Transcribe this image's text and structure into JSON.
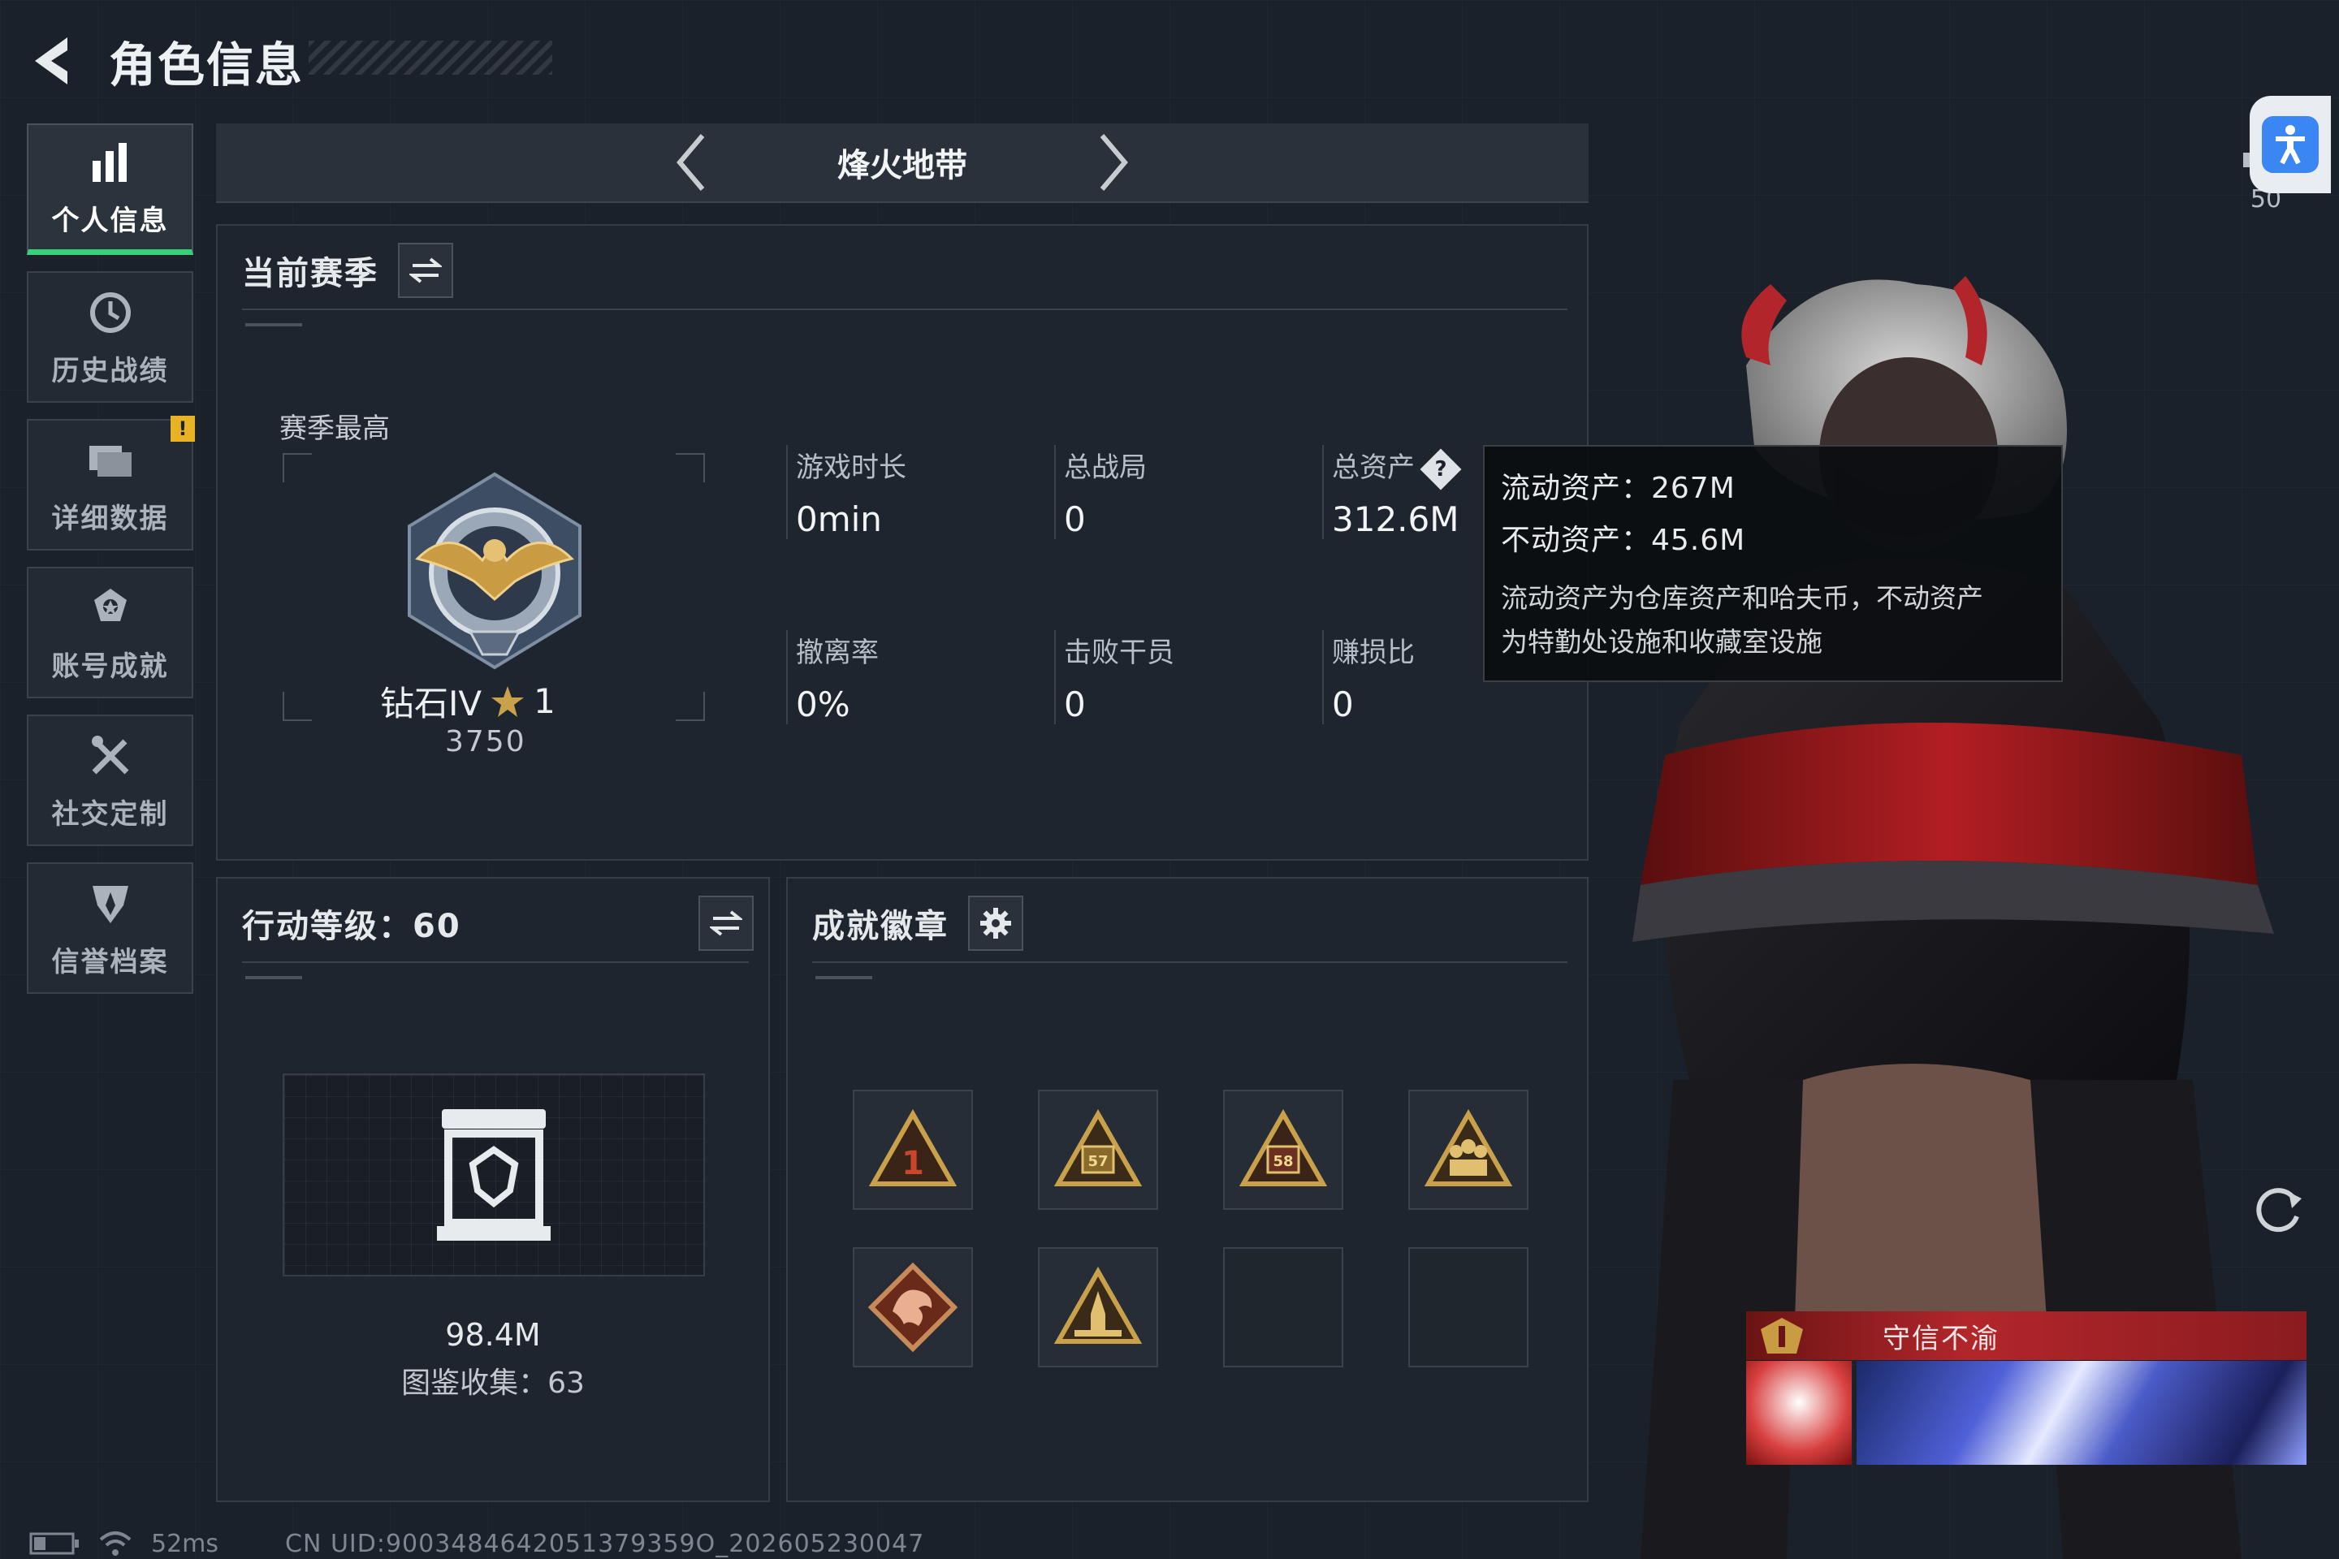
{
  "header": {
    "title": "角色信息"
  },
  "sidebar": {
    "items": [
      {
        "label": "个人信息",
        "icon": "bar-chart-icon",
        "active": true
      },
      {
        "label": "历史战绩",
        "icon": "history-clock-icon"
      },
      {
        "label": "详细数据",
        "icon": "folder-icon",
        "badge": "!"
      },
      {
        "label": "账号成就",
        "icon": "achievement-icon"
      },
      {
        "label": "社交定制",
        "icon": "tools-icon"
      },
      {
        "label": "信誉档案",
        "icon": "shield-icon"
      }
    ]
  },
  "mode_selector": {
    "current": "烽火地带"
  },
  "season_panel": {
    "title": "当前赛季",
    "best_label": "赛季最高",
    "rank_name": "钻石IV",
    "rank_stars": "1",
    "rank_score": "3750",
    "stats": [
      {
        "label": "游戏时长",
        "value": "0min"
      },
      {
        "label": "总战局",
        "value": "0"
      },
      {
        "label": "总资产",
        "value": "312.6M",
        "has_help": true
      },
      {
        "label": "撤离率",
        "value": "0%"
      },
      {
        "label": "击败干员",
        "value": "0"
      },
      {
        "label": "赚损比",
        "value": "0"
      }
    ]
  },
  "tooltip": {
    "liquid": "流动资产：267M",
    "fixed": "不动资产：45.6M",
    "description_line1": "流动资产为仓库资产和哈夫币，不动资产",
    "description_line2": "为特勤处设施和收藏室设施"
  },
  "level_panel": {
    "title": "行动等级：60",
    "value": "98.4M",
    "collection": "图鉴收集：63"
  },
  "badge_panel": {
    "title": "成就徽章",
    "badges": [
      {
        "icon": "badge-rank-1-icon",
        "label": "1",
        "empty": false
      },
      {
        "icon": "badge-57-icon",
        "label": "57",
        "empty": false
      },
      {
        "icon": "badge-58-icon",
        "label": "58",
        "empty": false
      },
      {
        "icon": "badge-squad-icon",
        "label": "",
        "empty": false
      },
      {
        "icon": "badge-dragon-icon",
        "label": "",
        "empty": false
      },
      {
        "icon": "badge-rocket-icon",
        "label": "",
        "empty": false
      },
      {
        "icon": "",
        "label": "",
        "empty": true
      },
      {
        "icon": "",
        "label": "",
        "empty": true
      }
    ]
  },
  "right": {
    "ping_value": "50",
    "title_card": "守信不渝"
  },
  "status_bar": {
    "latency": "52ms",
    "uid": "CN UID:9003484642051379359O_202605230047"
  },
  "colors": {
    "accent_green": "#39d07a",
    "warning": "#e8b224",
    "title_red": "#b2262b",
    "access_blue": "#3a86f2"
  }
}
